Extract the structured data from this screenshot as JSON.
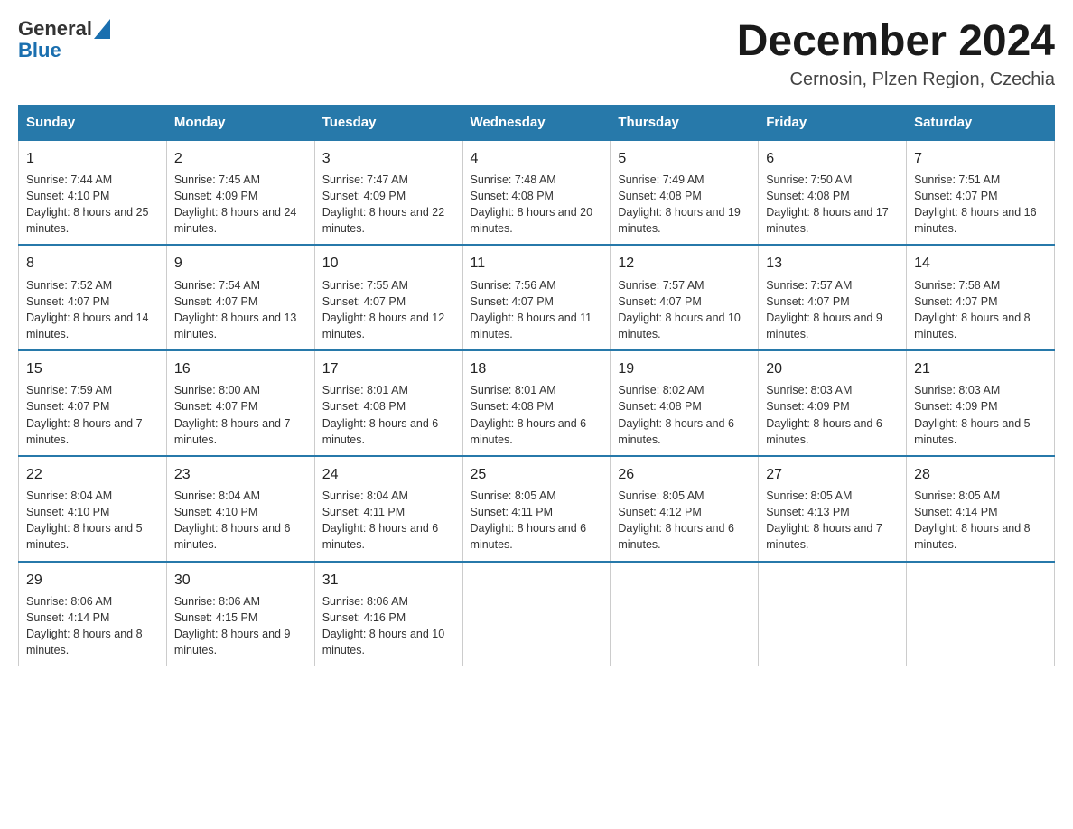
{
  "header": {
    "logo_general": "General",
    "logo_blue": "Blue",
    "title": "December 2024",
    "subtitle": "Cernosin, Plzen Region, Czechia"
  },
  "weekdays": [
    "Sunday",
    "Monday",
    "Tuesday",
    "Wednesday",
    "Thursday",
    "Friday",
    "Saturday"
  ],
  "weeks": [
    [
      {
        "day": "1",
        "sunrise": "7:44 AM",
        "sunset": "4:10 PM",
        "daylight": "8 hours and 25 minutes."
      },
      {
        "day": "2",
        "sunrise": "7:45 AM",
        "sunset": "4:09 PM",
        "daylight": "8 hours and 24 minutes."
      },
      {
        "day": "3",
        "sunrise": "7:47 AM",
        "sunset": "4:09 PM",
        "daylight": "8 hours and 22 minutes."
      },
      {
        "day": "4",
        "sunrise": "7:48 AM",
        "sunset": "4:08 PM",
        "daylight": "8 hours and 20 minutes."
      },
      {
        "day": "5",
        "sunrise": "7:49 AM",
        "sunset": "4:08 PM",
        "daylight": "8 hours and 19 minutes."
      },
      {
        "day": "6",
        "sunrise": "7:50 AM",
        "sunset": "4:08 PM",
        "daylight": "8 hours and 17 minutes."
      },
      {
        "day": "7",
        "sunrise": "7:51 AM",
        "sunset": "4:07 PM",
        "daylight": "8 hours and 16 minutes."
      }
    ],
    [
      {
        "day": "8",
        "sunrise": "7:52 AM",
        "sunset": "4:07 PM",
        "daylight": "8 hours and 14 minutes."
      },
      {
        "day": "9",
        "sunrise": "7:54 AM",
        "sunset": "4:07 PM",
        "daylight": "8 hours and 13 minutes."
      },
      {
        "day": "10",
        "sunrise": "7:55 AM",
        "sunset": "4:07 PM",
        "daylight": "8 hours and 12 minutes."
      },
      {
        "day": "11",
        "sunrise": "7:56 AM",
        "sunset": "4:07 PM",
        "daylight": "8 hours and 11 minutes."
      },
      {
        "day": "12",
        "sunrise": "7:57 AM",
        "sunset": "4:07 PM",
        "daylight": "8 hours and 10 minutes."
      },
      {
        "day": "13",
        "sunrise": "7:57 AM",
        "sunset": "4:07 PM",
        "daylight": "8 hours and 9 minutes."
      },
      {
        "day": "14",
        "sunrise": "7:58 AM",
        "sunset": "4:07 PM",
        "daylight": "8 hours and 8 minutes."
      }
    ],
    [
      {
        "day": "15",
        "sunrise": "7:59 AM",
        "sunset": "4:07 PM",
        "daylight": "8 hours and 7 minutes."
      },
      {
        "day": "16",
        "sunrise": "8:00 AM",
        "sunset": "4:07 PM",
        "daylight": "8 hours and 7 minutes."
      },
      {
        "day": "17",
        "sunrise": "8:01 AM",
        "sunset": "4:08 PM",
        "daylight": "8 hours and 6 minutes."
      },
      {
        "day": "18",
        "sunrise": "8:01 AM",
        "sunset": "4:08 PM",
        "daylight": "8 hours and 6 minutes."
      },
      {
        "day": "19",
        "sunrise": "8:02 AM",
        "sunset": "4:08 PM",
        "daylight": "8 hours and 6 minutes."
      },
      {
        "day": "20",
        "sunrise": "8:03 AM",
        "sunset": "4:09 PM",
        "daylight": "8 hours and 6 minutes."
      },
      {
        "day": "21",
        "sunrise": "8:03 AM",
        "sunset": "4:09 PM",
        "daylight": "8 hours and 5 minutes."
      }
    ],
    [
      {
        "day": "22",
        "sunrise": "8:04 AM",
        "sunset": "4:10 PM",
        "daylight": "8 hours and 5 minutes."
      },
      {
        "day": "23",
        "sunrise": "8:04 AM",
        "sunset": "4:10 PM",
        "daylight": "8 hours and 6 minutes."
      },
      {
        "day": "24",
        "sunrise": "8:04 AM",
        "sunset": "4:11 PM",
        "daylight": "8 hours and 6 minutes."
      },
      {
        "day": "25",
        "sunrise": "8:05 AM",
        "sunset": "4:11 PM",
        "daylight": "8 hours and 6 minutes."
      },
      {
        "day": "26",
        "sunrise": "8:05 AM",
        "sunset": "4:12 PM",
        "daylight": "8 hours and 6 minutes."
      },
      {
        "day": "27",
        "sunrise": "8:05 AM",
        "sunset": "4:13 PM",
        "daylight": "8 hours and 7 minutes."
      },
      {
        "day": "28",
        "sunrise": "8:05 AM",
        "sunset": "4:14 PM",
        "daylight": "8 hours and 8 minutes."
      }
    ],
    [
      {
        "day": "29",
        "sunrise": "8:06 AM",
        "sunset": "4:14 PM",
        "daylight": "8 hours and 8 minutes."
      },
      {
        "day": "30",
        "sunrise": "8:06 AM",
        "sunset": "4:15 PM",
        "daylight": "8 hours and 9 minutes."
      },
      {
        "day": "31",
        "sunrise": "8:06 AM",
        "sunset": "4:16 PM",
        "daylight": "8 hours and 10 minutes."
      },
      null,
      null,
      null,
      null
    ]
  ]
}
